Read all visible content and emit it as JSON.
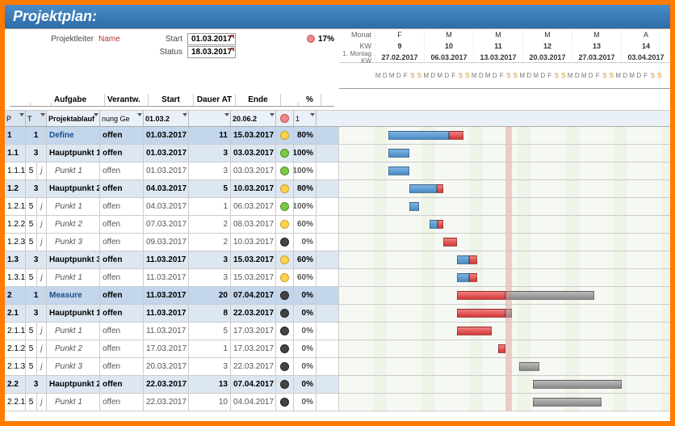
{
  "title": "Projektplan:",
  "header": {
    "pl_label": "Projektleiter",
    "pl_value": "Name",
    "start_label": "Start",
    "start_value": "01.03.2017",
    "status_label": "Status",
    "status_value": "18.03.2017",
    "progress": "17%"
  },
  "timeline": {
    "monat_label": "Monat",
    "kw_label": "KW",
    "montag_label": "1. Montag KW",
    "months": [
      "F",
      "M",
      "M",
      "M",
      "M",
      "A"
    ],
    "kws": [
      "9",
      "10",
      "11",
      "12",
      "13",
      "14"
    ],
    "dates": [
      "27.02.2017",
      "06.03.2017",
      "13.03.2017",
      "20.03.2017",
      "27.03.2017",
      "03.04.2017"
    ],
    "day_pattern": [
      "M",
      "D",
      "M",
      "D",
      "F",
      "S",
      "S"
    ]
  },
  "columns": {
    "aufgabe": "Aufgabe",
    "verantw": "Verantw.",
    "start": "Start",
    "dauer": "Dauer AT",
    "ende": "Ende",
    "pct": "%"
  },
  "filter": {
    "p1": "P",
    "p2": "T",
    "task": "Projektablauf",
    "resp": "nung Ge",
    "start": "01.03.2",
    "end": "20.06.2",
    "pct": "1"
  },
  "chart_data": {
    "type": "gantt",
    "x_start": "27.02.2017",
    "x_end": "09.04.2017",
    "today": "18.03.2017",
    "tasks": [
      {
        "id": "1",
        "lvl": 0,
        "p": "1",
        "task": "Define",
        "resp": "offen",
        "start": "01.03.2017",
        "dur": 11,
        "end": "15.03.2017",
        "status": "yellow",
        "pct": "80%",
        "bar_start": 2,
        "bar_len": 11,
        "progress": 0.8
      },
      {
        "id": "1.1",
        "lvl": 1,
        "p": "3",
        "task": "Hauptpunkt 1",
        "resp": "offen",
        "start": "01.03.2017",
        "dur": 3,
        "end": "03.03.2017",
        "status": "green",
        "pct": "100%",
        "bar_start": 2,
        "bar_len": 3,
        "progress": 1.0
      },
      {
        "id": "1.1.1",
        "lvl": 2,
        "p": "5",
        "j": "j",
        "task": "Punkt 1",
        "resp": "offen",
        "start": "01.03.2017",
        "dur": 3,
        "end": "03.03.2017",
        "status": "green",
        "pct": "100%",
        "bar_start": 2,
        "bar_len": 3,
        "progress": 1.0
      },
      {
        "id": "1.2",
        "lvl": 1,
        "p": "3",
        "task": "Hauptpunkt 2",
        "resp": "offen",
        "start": "04.03.2017",
        "dur": 5,
        "end": "10.03.2017",
        "status": "yellow",
        "pct": "80%",
        "bar_start": 5,
        "bar_len": 5,
        "progress": 0.8
      },
      {
        "id": "1.2.1",
        "lvl": 2,
        "p": "5",
        "j": "j",
        "task": "Punkt 1",
        "resp": "offen",
        "start": "04.03.2017",
        "dur": 1,
        "end": "06.03.2017",
        "status": "green",
        "pct": "100%",
        "bar_start": 5,
        "bar_len": 1.5,
        "progress": 1.0
      },
      {
        "id": "1.2.2",
        "lvl": 2,
        "p": "5",
        "j": "j",
        "task": "Punkt 2",
        "resp": "offen",
        "start": "07.03.2017",
        "dur": 2,
        "end": "08.03.2017",
        "status": "yellow",
        "pct": "60%",
        "bar_start": 8,
        "bar_len": 2,
        "progress": 0.6
      },
      {
        "id": "1.2.3",
        "lvl": 2,
        "p": "5",
        "j": "j",
        "task": "Punkt 3",
        "resp": "offen",
        "start": "09.03.2017",
        "dur": 2,
        "end": "10.03.2017",
        "status": "dark",
        "pct": "0%",
        "bar_start": 10,
        "bar_len": 2,
        "progress": 0
      },
      {
        "id": "1.3",
        "lvl": 1,
        "p": "3",
        "task": "Hauptpunkt 3",
        "resp": "offen",
        "start": "11.03.2017",
        "dur": 3,
        "end": "15.03.2017",
        "status": "yellow",
        "pct": "60%",
        "bar_start": 12,
        "bar_len": 3,
        "progress": 0.6
      },
      {
        "id": "1.3.1",
        "lvl": 2,
        "p": "5",
        "j": "j",
        "task": "Punkt 1",
        "resp": "offen",
        "start": "11.03.2017",
        "dur": 3,
        "end": "15.03.2017",
        "status": "yellow",
        "pct": "60%",
        "bar_start": 12,
        "bar_len": 3,
        "progress": 0.6
      },
      {
        "id": "2",
        "lvl": 0,
        "p": "1",
        "task": "Measure",
        "resp": "offen",
        "start": "11.03.2017",
        "dur": 20,
        "end": "07.04.2017",
        "status": "dark",
        "pct": "0%",
        "bar_start": 12,
        "bar_len": 20,
        "progress": 0,
        "gray": true
      },
      {
        "id": "2.1",
        "lvl": 1,
        "p": "3",
        "task": "Hauptpunkt 1",
        "resp": "offen",
        "start": "11.03.2017",
        "dur": 8,
        "end": "22.03.2017",
        "status": "dark",
        "pct": "0%",
        "bar_start": 12,
        "bar_len": 8,
        "progress": 0,
        "gray": true
      },
      {
        "id": "2.1.1",
        "lvl": 2,
        "p": "5",
        "j": "j",
        "task": "Punkt 1",
        "resp": "offen",
        "start": "11.03.2017",
        "dur": 5,
        "end": "17.03.2017",
        "status": "dark",
        "pct": "0%",
        "bar_start": 12,
        "bar_len": 5,
        "progress": 0,
        "gray": true
      },
      {
        "id": "2.1.2",
        "lvl": 2,
        "p": "5",
        "j": "j",
        "task": "Punkt 2",
        "resp": "offen",
        "start": "17.03.2017",
        "dur": 1,
        "end": "17.03.2017",
        "status": "dark",
        "pct": "0%",
        "bar_start": 18,
        "bar_len": 1,
        "progress": 0,
        "gray": true
      },
      {
        "id": "2.1.3",
        "lvl": 2,
        "p": "5",
        "j": "j",
        "task": "Punkt 3",
        "resp": "offen",
        "start": "20.03.2017",
        "dur": 3,
        "end": "22.03.2017",
        "status": "dark",
        "pct": "0%",
        "bar_start": 21,
        "bar_len": 3,
        "progress": 0,
        "gray": true
      },
      {
        "id": "2.2",
        "lvl": 1,
        "p": "3",
        "task": "Hauptpunkt 2",
        "resp": "offen",
        "start": "22.03.2017",
        "dur": 13,
        "end": "07.04.2017",
        "status": "dark",
        "pct": "0%",
        "bar_start": 23,
        "bar_len": 13,
        "progress": 0,
        "gray": true
      },
      {
        "id": "2.2.1",
        "lvl": 2,
        "p": "5",
        "j": "j",
        "task": "Punkt 1",
        "resp": "offen",
        "start": "22.03.2017",
        "dur": 10,
        "end": "04.04.2017",
        "status": "dark",
        "pct": "0%",
        "bar_start": 23,
        "bar_len": 10,
        "progress": 0,
        "gray": true
      }
    ]
  }
}
